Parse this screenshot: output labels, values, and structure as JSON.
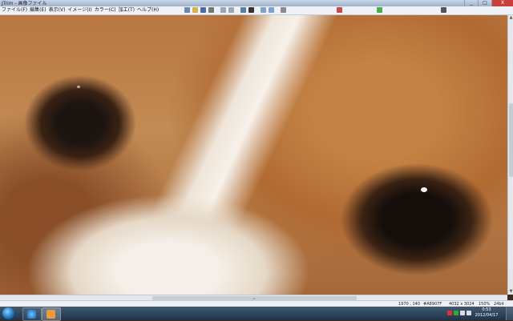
{
  "window": {
    "title": "JTrim - 画像ファイル",
    "minimize": "_",
    "maximize": "□",
    "close": "X"
  },
  "menu": {
    "items": [
      "ファイル(F)",
      "編集(E)",
      "表示(V)",
      "イメージ(I)",
      "カラー(C)",
      "加工(T)",
      "ヘルプ(H)"
    ]
  },
  "toolbar": {
    "icons": [
      "new-icon",
      "open-icon",
      "save-icon",
      "print-icon",
      "undo-icon",
      "redo-icon",
      "crop-icon",
      "text-icon",
      "zoom-in-icon",
      "zoom-out-icon",
      "rotate-icon",
      "brush-icon",
      "color-icon",
      "gear-icon"
    ]
  },
  "status": {
    "coords": "1970 , 140",
    "color": "#A8907F",
    "size": "4032 x 3024",
    "zoom": "150%",
    "depth": "24bit"
  },
  "taskbar": {
    "time": "0:53",
    "date": "2012/04/17"
  },
  "colors": {
    "titlebar": "#b5c5d8",
    "close": "#c7413a",
    "taskbar": "#2a4258"
  }
}
